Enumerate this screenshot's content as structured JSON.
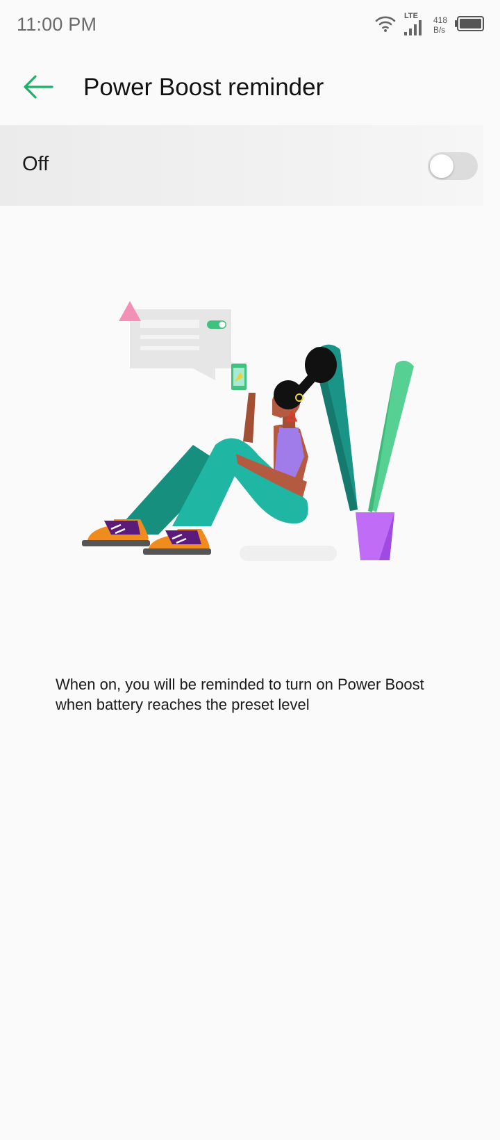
{
  "status_bar": {
    "time": "11:00 PM",
    "network_type": "LTE",
    "speed_value": "418",
    "speed_unit": "B/s",
    "icons": [
      "wifi-icon",
      "signal-icon",
      "battery-icon"
    ]
  },
  "header": {
    "title": "Power Boost reminder",
    "back_icon": "arrow-left-icon"
  },
  "toggle": {
    "label": "Off",
    "state": false
  },
  "description": "When on, you will be reminded to turn on Power Boost when battery reaches the preset level",
  "colors": {
    "accent": "#1db06a",
    "switch_track_off": "#dcdcdc",
    "background": "#fafafa"
  }
}
